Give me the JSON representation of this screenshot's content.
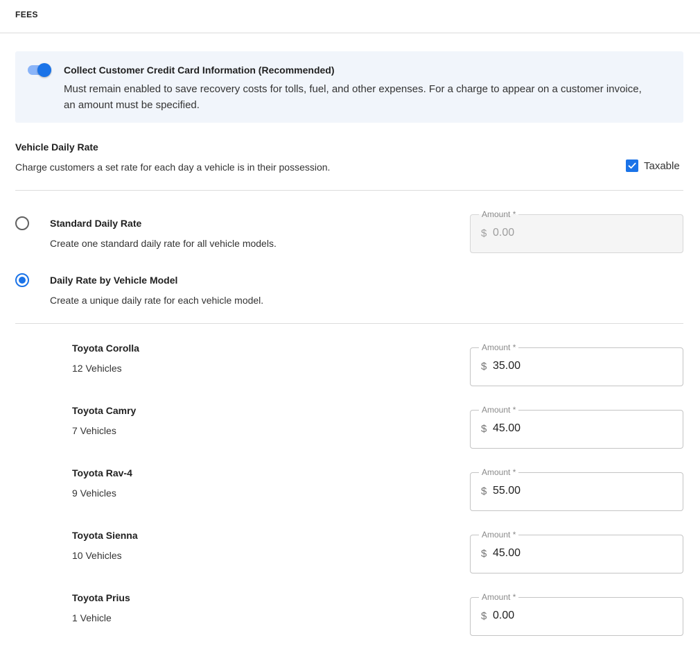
{
  "header": {
    "title": "FEES"
  },
  "banner": {
    "title": "Collect Customer Credit Card Information (Recommended)",
    "description": "Must remain enabled to save recovery costs for tolls, fuel, and other expenses. For a charge to appear on a customer invoice, an amount must be specified.",
    "toggle_on": true
  },
  "daily_rate": {
    "title": "Vehicle Daily Rate",
    "description": "Charge customers a set rate for each day a vehicle is in their possession.",
    "taxable_label": "Taxable",
    "taxable_checked": true
  },
  "options": {
    "standard": {
      "title": "Standard Daily Rate",
      "description": "Create one standard daily rate for all vehicle models.",
      "selected": false,
      "amount_label": "Amount *",
      "currency": "$",
      "amount": "0.00"
    },
    "by_model": {
      "title": "Daily Rate by Vehicle Model",
      "description": "Create a unique daily rate for each vehicle model.",
      "selected": true
    }
  },
  "models": [
    {
      "name": "Toyota Corolla",
      "count": "12 Vehicles",
      "amount_label": "Amount *",
      "currency": "$",
      "amount": "35.00"
    },
    {
      "name": "Toyota Camry",
      "count": "7 Vehicles",
      "amount_label": "Amount *",
      "currency": "$",
      "amount": "45.00"
    },
    {
      "name": "Toyota Rav-4",
      "count": "9 Vehicles",
      "amount_label": "Amount *",
      "currency": "$",
      "amount": "55.00"
    },
    {
      "name": "Toyota Sienna",
      "count": "10 Vehicles",
      "amount_label": "Amount *",
      "currency": "$",
      "amount": "45.00"
    },
    {
      "name": "Toyota Prius",
      "count": "1 Vehicle",
      "amount_label": "Amount *",
      "currency": "$",
      "amount": "0.00"
    }
  ],
  "colors": {
    "accent": "#1a73e8",
    "banner_bg": "#f1f5fb",
    "divider": "#dcdcdc"
  }
}
